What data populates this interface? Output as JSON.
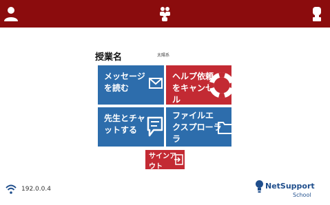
{
  "topbar": {
    "background": "#8b0c0d",
    "icons": [
      "user-icon",
      "group-icon",
      "raise-hand-icon"
    ]
  },
  "class": {
    "label": "授業名",
    "name": "太陽系"
  },
  "tiles": [
    {
      "label": "メッセージ\nを読む",
      "color": "#2d6dac",
      "icon": "envelope-icon"
    },
    {
      "label": "ヘルプ依頼\nをキャンセ\nル",
      "color": "#c32a33",
      "icon": "lifebuoy-icon"
    },
    {
      "label": "先生とチャ\nットする",
      "color": "#2d6dac",
      "icon": "chat-icon"
    },
    {
      "label": "ファイルエ\nクスプローラ\nラ",
      "color": "#2d6dac",
      "icon": "folder-icon"
    },
    {
      "label": "サインア\nウト",
      "color": "#c32a33",
      "icon": "sign-out-icon"
    }
  ],
  "status": {
    "ip": "192.0.0.4",
    "icon": "wifi-icon"
  },
  "brand": {
    "name": "NetSupport",
    "sub": "School"
  }
}
